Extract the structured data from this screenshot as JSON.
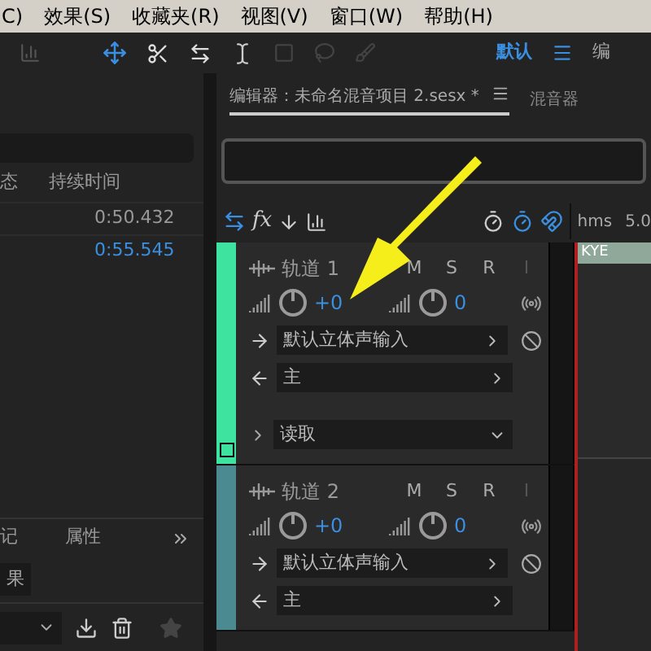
{
  "menu": [
    "C)",
    "效果(S)",
    "收藏夹(R)",
    "视图(V)",
    "窗口(W)",
    "帮助(H)"
  ],
  "toolbar": {
    "workspace": "默认",
    "next": "编"
  },
  "left_panel": {
    "columns": [
      "态",
      "持续时间"
    ],
    "rows": [
      {
        "duration": "0:50.432",
        "selected": false
      },
      {
        "duration": "0:55.545",
        "selected": true
      }
    ],
    "tabs": [
      "记",
      "属性"
    ],
    "button": "果"
  },
  "editor": {
    "effects_label": "fx",
    "tabs": [
      {
        "label": "编辑器：未命名混音项目 2.sesx *",
        "selected": true
      },
      {
        "label": "混音器",
        "selected": false
      }
    ]
  },
  "ruler": [
    "hms",
    "5.0"
  ],
  "clip": "KYE",
  "tracks": [
    {
      "name": "轨道 1",
      "color": "#3ee3a0",
      "buttons": [
        {
          "label": "M",
          "disabled": false
        },
        {
          "label": "S",
          "disabled": false
        },
        {
          "label": "R",
          "disabled": false
        },
        {
          "label": "I",
          "disabled": true
        }
      ],
      "volume": "+0",
      "pan": "0",
      "input": "默认立体声输入",
      "output": "主",
      "automation": "读取"
    },
    {
      "name": "轨道 2",
      "color": "#4a8a90",
      "buttons": [
        {
          "label": "M",
          "disabled": false
        },
        {
          "label": "S",
          "disabled": false
        },
        {
          "label": "R",
          "disabled": false
        },
        {
          "label": "I",
          "disabled": true
        }
      ],
      "volume": "+0",
      "pan": "0",
      "input": "默认立体声输入",
      "output": "主"
    }
  ]
}
